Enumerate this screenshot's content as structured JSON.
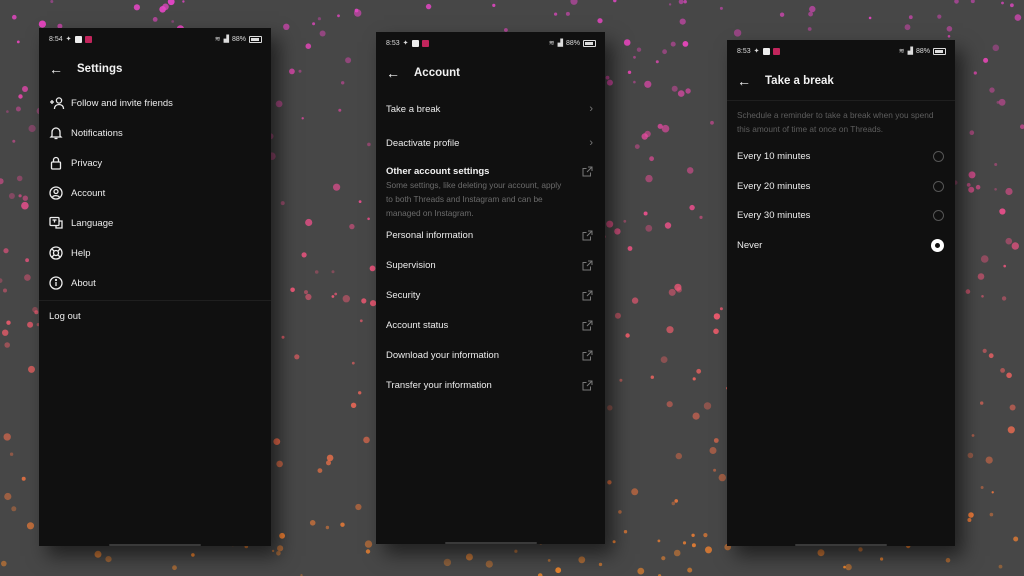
{
  "colors": {
    "background": "#474747",
    "panel": "#101010",
    "text": "#ececec",
    "muted": "#6c6c6c",
    "accent_red": "#c2255c"
  },
  "screens": [
    {
      "status": {
        "time": "8:54",
        "battery": "88%"
      },
      "header": {
        "back_icon": "arrow-left-icon",
        "title": "Settings"
      },
      "items": [
        {
          "label": "Follow and invite friends",
          "icon": "add-person-icon"
        },
        {
          "label": "Notifications",
          "icon": "bell-icon"
        },
        {
          "label": "Privacy",
          "icon": "lock-icon"
        },
        {
          "label": "Account",
          "icon": "account-circle-icon"
        },
        {
          "label": "Language",
          "icon": "language-icon"
        },
        {
          "label": "Help",
          "icon": "lifebuoy-icon"
        },
        {
          "label": "About",
          "icon": "info-icon"
        }
      ],
      "logout_label": "Log out"
    },
    {
      "status": {
        "time": "8:53",
        "battery": "88%"
      },
      "header": {
        "back_icon": "arrow-left-icon",
        "title": "Account"
      },
      "items": [
        {
          "label": "Take a break",
          "icon": "chevron-right-icon"
        },
        {
          "label": "Deactivate profile",
          "icon": "chevron-right-icon"
        }
      ],
      "other": {
        "title": "Other account settings",
        "description": "Some settings, like deleting your account, apply to both Threads and Instagram and can be managed on Instagram."
      },
      "links": [
        {
          "label": "Personal information",
          "icon": "external-link-icon"
        },
        {
          "label": "Supervision",
          "icon": "external-link-icon"
        },
        {
          "label": "Security",
          "icon": "external-link-icon"
        },
        {
          "label": "Account status",
          "icon": "external-link-icon"
        },
        {
          "label": "Download your information",
          "icon": "external-link-icon"
        },
        {
          "label": "Transfer your information",
          "icon": "external-link-icon"
        }
      ]
    },
    {
      "status": {
        "time": "8:53",
        "battery": "88%"
      },
      "header": {
        "back_icon": "arrow-left-icon",
        "title": "Take a break"
      },
      "description": "Schedule a reminder to take a break when you spend this amount of time at once on Threads.",
      "options": [
        {
          "label": "Every 10 minutes",
          "selected": false
        },
        {
          "label": "Every 20 minutes",
          "selected": false
        },
        {
          "label": "Every 30 minutes",
          "selected": false
        },
        {
          "label": "Never",
          "selected": true
        }
      ]
    }
  ]
}
